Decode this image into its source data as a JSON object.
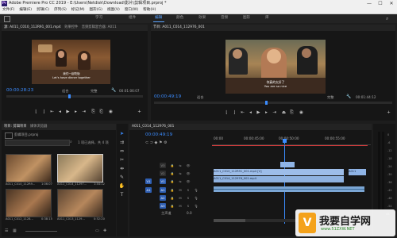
{
  "app": {
    "icon_text": "Pr",
    "title": "Adobe Premiere Pro CC 2019 - E:\\Users\\Netdisk\\Download\\影片\\剪辑项目.prproj *",
    "min": "—",
    "max": "☐",
    "close": "✕"
  },
  "menu": [
    "文件(F)",
    "编辑(E)",
    "剪辑(C)",
    "序列(S)",
    "标记(M)",
    "图形(G)",
    "视图(V)",
    "窗口(W)",
    "帮助(H)"
  ],
  "workspaces": [
    "学习",
    "组件",
    "编辑",
    "颜色",
    "效果",
    "音频",
    "图形",
    "库"
  ],
  "workspaces_active": "编辑",
  "source": {
    "tabs": [
      "源: A011_C010_112R91_001.mp4",
      "效果控件",
      "音频剪辑混合器: A011"
    ],
    "timecode": "00:00:28:23",
    "fit": "适合",
    "quality": "完整",
    "duration": "00:01:06:07",
    "subtitle_line1": "我们一起吃饭",
    "subtitle_line2": "Let's have dinner together"
  },
  "program": {
    "tab": "节目: A011_C014_112976_001",
    "timecode": "00:00:49:19",
    "fit": "适合",
    "quality": "完整",
    "duration": "00:01:44:12",
    "subtitle_line1": "你真的太好了",
    "subtitle_line2": "You are so nice"
  },
  "project": {
    "tabs": [
      "项目: 剪辑项目",
      "媒体浏览器"
    ],
    "filename": "剪辑项目.prproj",
    "count": "1 项已选择，共 4 项",
    "items": [
      {
        "name": "A011_C010_112R9...",
        "dur": "1:06:07"
      },
      {
        "name": "A011_C014_11297...",
        "dur": "1:44:12"
      },
      {
        "name": "A011_C012_1128...",
        "dur": "0:38:15"
      },
      {
        "name": "A011_C013_1129...",
        "dur": "0:52:20"
      }
    ]
  },
  "timeline": {
    "tab": "A011_C014_112976_001",
    "timecode": "00:00:49:19",
    "ruler": [
      "00:00",
      "00:00:45:00",
      "00:00:50:00",
      "00:00:55:00"
    ],
    "tracks": [
      "V3",
      "V2",
      "V1",
      "A1",
      "A2",
      "A3"
    ],
    "master": "主声道",
    "master_value": "0.0",
    "clip_v1a": "A011_C010_112R91_001.mp4 [V]",
    "clip_v1b": "A011_C014_112976_001.mp4",
    "clip_v1c": "A011",
    "clip_v1d": "A011_C014_112976_001"
  },
  "meters": [
    "0",
    "-6",
    "-12",
    "-18",
    "-24",
    "-30",
    "-36",
    "-42",
    "-48",
    "-54",
    "dB"
  ],
  "watermark": {
    "text": "我要自学网",
    "url": "www.51ZXW.NET"
  }
}
